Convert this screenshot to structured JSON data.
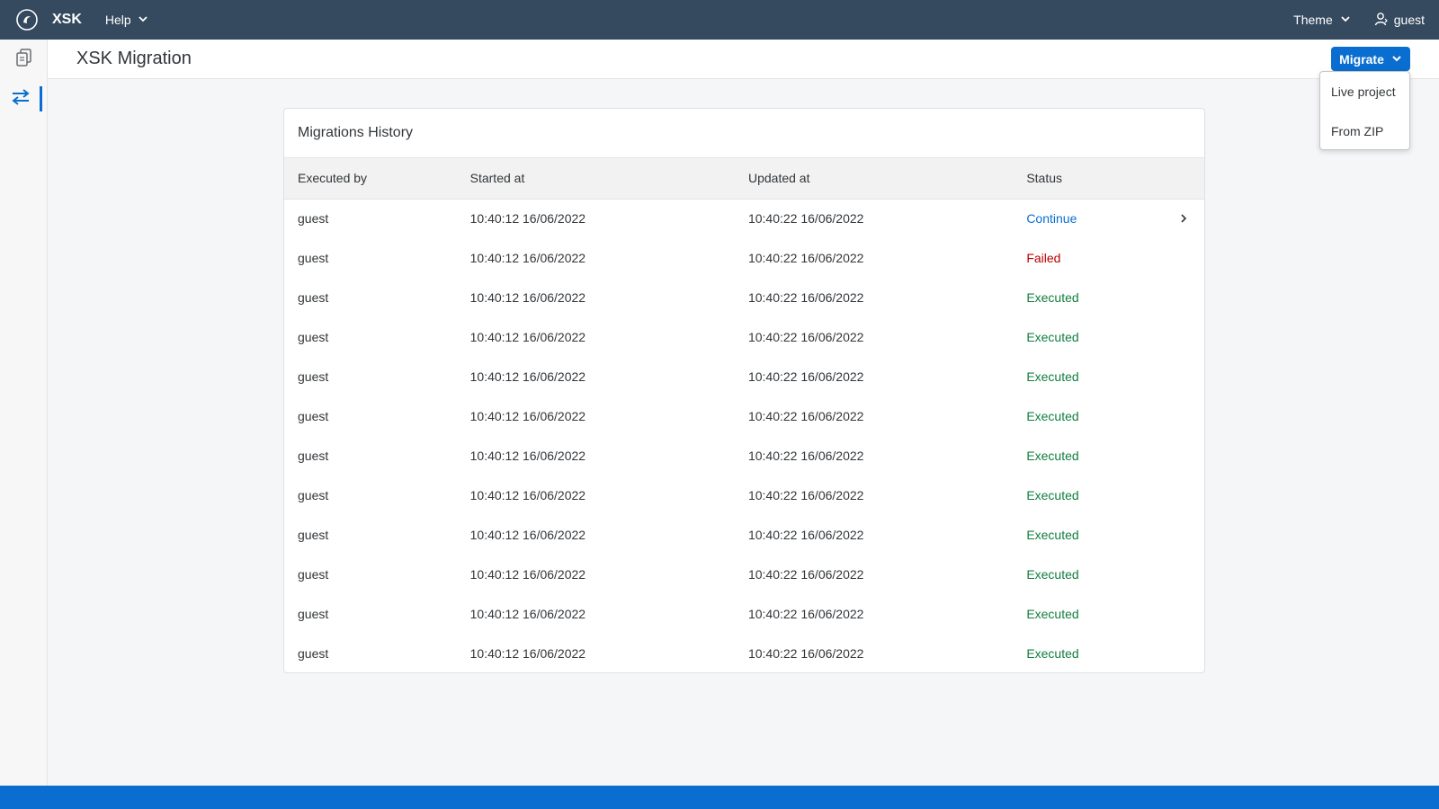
{
  "shell": {
    "app_name": "XSK",
    "help_label": "Help",
    "theme_label": "Theme",
    "user_label": "guest"
  },
  "header": {
    "title": "XSK Migration",
    "migrate_label": "Migrate"
  },
  "migrate_menu": {
    "items": [
      "Live project",
      "From ZIP"
    ]
  },
  "history": {
    "title": "Migrations History",
    "columns": [
      "Executed by",
      "Started at",
      "Updated at",
      "Status"
    ],
    "rows": [
      {
        "by": "guest",
        "started": "10:40:12 16/06/2022",
        "updated": "10:40:22 16/06/2022",
        "status": "Continue"
      },
      {
        "by": "guest",
        "started": "10:40:12 16/06/2022",
        "updated": "10:40:22 16/06/2022",
        "status": "Failed"
      },
      {
        "by": "guest",
        "started": "10:40:12 16/06/2022",
        "updated": "10:40:22 16/06/2022",
        "status": "Executed"
      },
      {
        "by": "guest",
        "started": "10:40:12 16/06/2022",
        "updated": "10:40:22 16/06/2022",
        "status": "Executed"
      },
      {
        "by": "guest",
        "started": "10:40:12 16/06/2022",
        "updated": "10:40:22 16/06/2022",
        "status": "Executed"
      },
      {
        "by": "guest",
        "started": "10:40:12 16/06/2022",
        "updated": "10:40:22 16/06/2022",
        "status": "Executed"
      },
      {
        "by": "guest",
        "started": "10:40:12 16/06/2022",
        "updated": "10:40:22 16/06/2022",
        "status": "Executed"
      },
      {
        "by": "guest",
        "started": "10:40:12 16/06/2022",
        "updated": "10:40:22 16/06/2022",
        "status": "Executed"
      },
      {
        "by": "guest",
        "started": "10:40:12 16/06/2022",
        "updated": "10:40:22 16/06/2022",
        "status": "Executed"
      },
      {
        "by": "guest",
        "started": "10:40:12 16/06/2022",
        "updated": "10:40:22 16/06/2022",
        "status": "Executed"
      },
      {
        "by": "guest",
        "started": "10:40:12 16/06/2022",
        "updated": "10:40:22 16/06/2022",
        "status": "Executed"
      },
      {
        "by": "guest",
        "started": "10:40:12 16/06/2022",
        "updated": "10:40:22 16/06/2022",
        "status": "Executed"
      }
    ]
  },
  "colors": {
    "shell": "#354a5f",
    "accent": "#0a6ed1",
    "failed": "#bb0000",
    "executed": "#107e3e"
  },
  "icons": {
    "logo": "app-logo-icon",
    "help_chevron": "chevron-down-icon",
    "theme_chevron": "chevron-down-icon",
    "user": "user-icon",
    "nav_1": "copy-documents-icon",
    "nav_2": "transfer-arrows-icon",
    "row_nav": "chevron-right-icon"
  }
}
